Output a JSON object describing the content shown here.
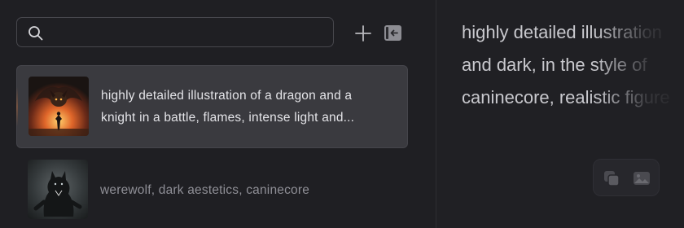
{
  "search": {
    "value": "",
    "placeholder": ""
  },
  "toolbar": {
    "add_icon": "plus-icon",
    "collapse_icon": "collapse-panel-icon"
  },
  "history": {
    "items": [
      {
        "line1": "highly detailed illustration of a dragon and a",
        "line2": "knight in a battle, flames, intense light and...",
        "selected": true,
        "thumb_icon": "dragon-knight-thumbnail"
      },
      {
        "label": "werewolf, dark aestetics, caninecore",
        "selected": false,
        "thumb_icon": "werewolf-thumbnail"
      }
    ]
  },
  "detail": {
    "lines": [
      "highly detailed illustration",
      "and dark, in the style of",
      "caninecore, realistic figure"
    ],
    "copy_icon": "copy-icon",
    "image_icon": "image-icon"
  },
  "colors": {
    "background": "#1f1f23",
    "selected_item": "#3a3a3f",
    "search_border": "#47474d",
    "text_primary": "#e4e4e8",
    "text_muted": "#8f8f96"
  }
}
